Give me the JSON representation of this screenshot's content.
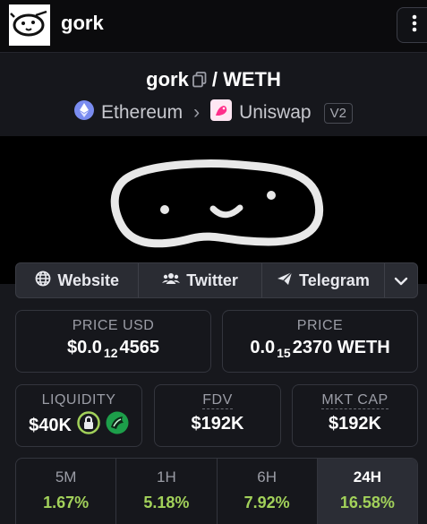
{
  "app": {
    "name": "gork"
  },
  "pair": {
    "base": "gork",
    "separator": "/",
    "quote": "WETH",
    "chain": "Ethereum",
    "dex": "Uniswap",
    "version": "V2"
  },
  "links": {
    "website": "Website",
    "twitter": "Twitter",
    "telegram": "Telegram"
  },
  "stats": {
    "price_usd": {
      "label": "PRICE USD",
      "prefix": "$0.0",
      "zeros": "12",
      "digits": "4565"
    },
    "price_native": {
      "label": "PRICE",
      "prefix": "0.0",
      "zeros": "15",
      "digits": "2370 WETH"
    },
    "liquidity": {
      "label": "LIQUIDITY",
      "value": "$40K"
    },
    "fdv": {
      "label": "FDV",
      "value": "$192K"
    },
    "mkt_cap": {
      "label": "MKT CAP",
      "value": "$192K"
    }
  },
  "performance": [
    {
      "label": "5M",
      "value": "1.67%"
    },
    {
      "label": "1H",
      "value": "5.18%"
    },
    {
      "label": "6H",
      "value": "7.92%"
    },
    {
      "label": "24H",
      "value": "16.58%"
    }
  ],
  "colors": {
    "positive": "#a2d15a",
    "lock_ring": "#a2d15a",
    "uniswap": "#ff2f8b",
    "ethereum": "#7a8cf0"
  },
  "icons": {
    "menu": "vertical-dots-icon",
    "copy": "copy-icon",
    "chain": "ethereum-icon",
    "dex": "uniswap-icon",
    "website": "globe-icon",
    "twitter": "people-icon",
    "telegram": "paper-plane-icon",
    "more": "chevron-down-icon",
    "lock": "lock-icon",
    "locker": "locker-logo-icon"
  }
}
